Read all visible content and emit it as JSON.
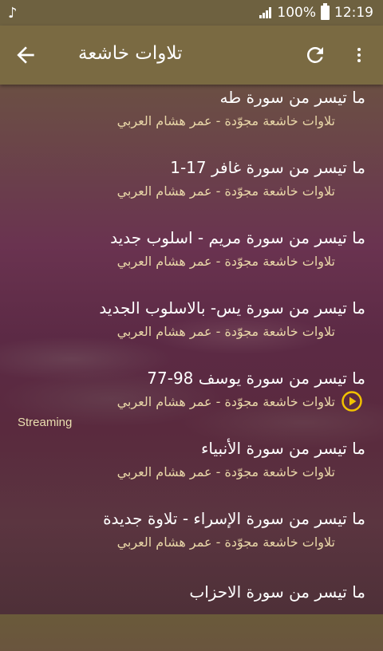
{
  "statusbar": {
    "battery_text": "100%",
    "time": "12:19",
    "icons": [
      "music-note-icon",
      "signal-icon",
      "battery-icon"
    ]
  },
  "appbar": {
    "title": "تلاوات خاشعة",
    "icons": [
      "back-arrow-icon",
      "refresh-icon",
      "more-vert-icon"
    ]
  },
  "tracks": [
    {
      "title": "ما تيسر من سورة طه",
      "subtitle": "تلاوات خاشعة مجوّدة - عمر هشام العربي"
    },
    {
      "title": "ما تيسر من سورة غافر 17-1",
      "subtitle": "تلاوات خاشعة مجوّدة - عمر هشام العربي"
    },
    {
      "title": "ما تيسر من سورة مريم - اسلوب جديد",
      "subtitle": "تلاوات خاشعة مجوّدة - عمر هشام العربي"
    },
    {
      "title": "ما تيسر من سورة يس- بالاسلوب الجديد",
      "subtitle": "تلاوات خاشعة مجوّدة - عمر هشام العربي"
    },
    {
      "title": "ما تيسر من سورة يوسف 98-77",
      "subtitle": "تلاوات خاشعة مجوّدة - عمر هشام العربي",
      "playing": true
    },
    {
      "title": "ما تيسر من سورة الأنبياء",
      "subtitle": "تلاوات خاشعة مجوّدة - عمر هشام العربي"
    },
    {
      "title": "ما تيسر من سورة الإسراء - تلاوة جديدة",
      "subtitle": "تلاوات خاشعة مجوّدة - عمر هشام العربي"
    },
    {
      "title": "ما تيسر من سورة الاحزاب",
      "subtitle": ""
    }
  ],
  "streaming_label": "Streaming",
  "colors": {
    "appbar": "#7a6a42",
    "subtitle": "#e9d7a8",
    "play_icon": "#f2c200"
  }
}
